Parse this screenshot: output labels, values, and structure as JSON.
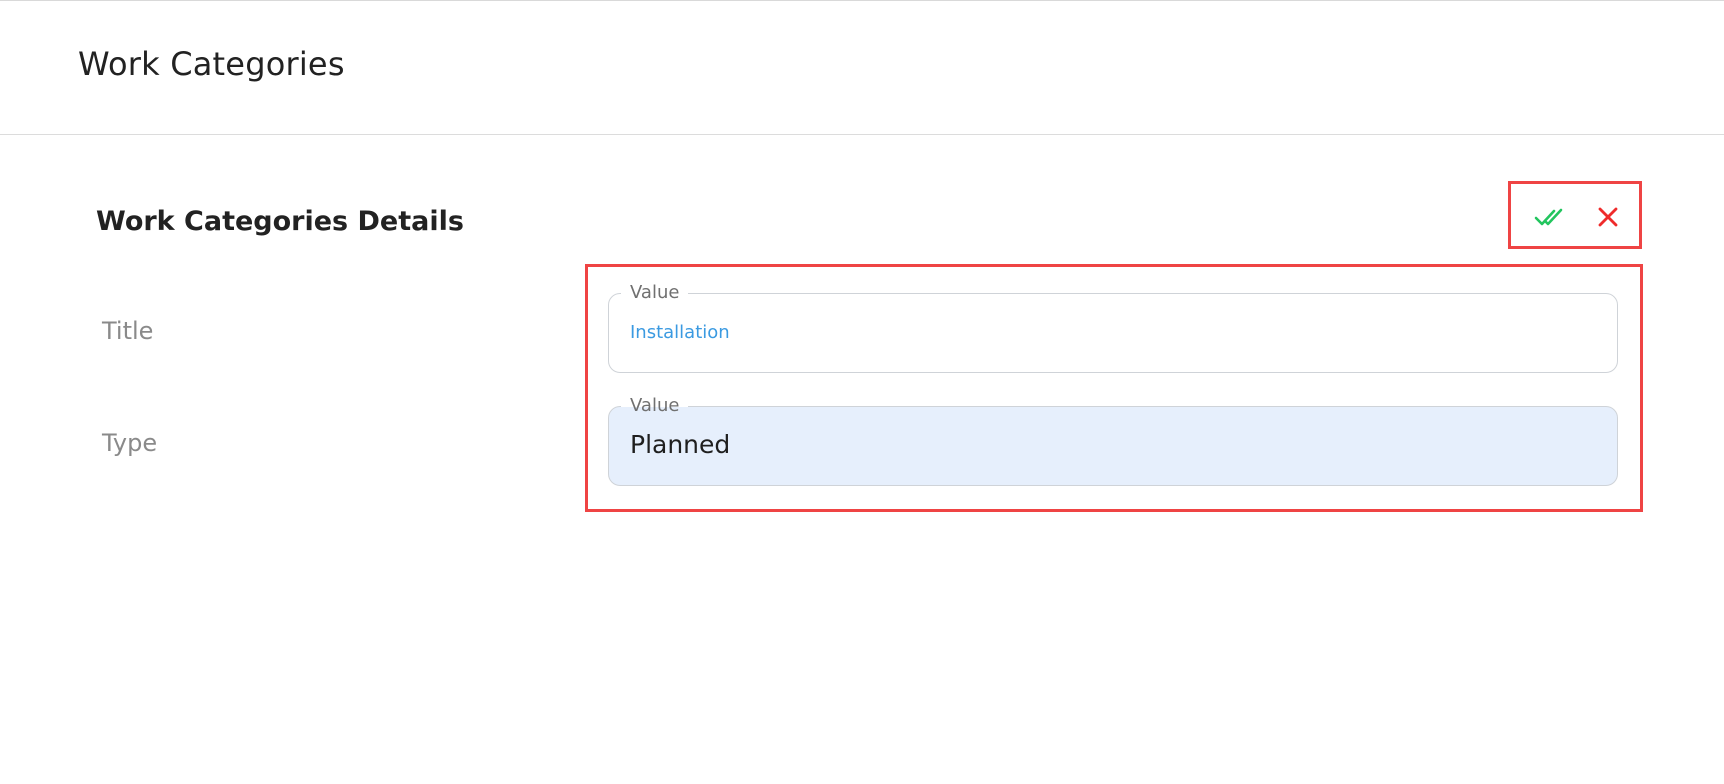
{
  "header": {
    "title": "Work Categories"
  },
  "details": {
    "section_title": "Work Categories Details",
    "actions": {
      "confirm_icon": "double-check-icon",
      "cancel_icon": "close-icon",
      "confirm_color": "#22c55e",
      "cancel_color": "#ef2b2b"
    },
    "fields": [
      {
        "label": "Title",
        "legend": "Value",
        "value": "Installation"
      },
      {
        "label": "Type",
        "legend": "Value",
        "value": "Planned"
      }
    ]
  },
  "colors": {
    "highlight_border": "#ef4444",
    "title_value": "#3b9ae1",
    "type_field_bg": "#e6effc"
  }
}
